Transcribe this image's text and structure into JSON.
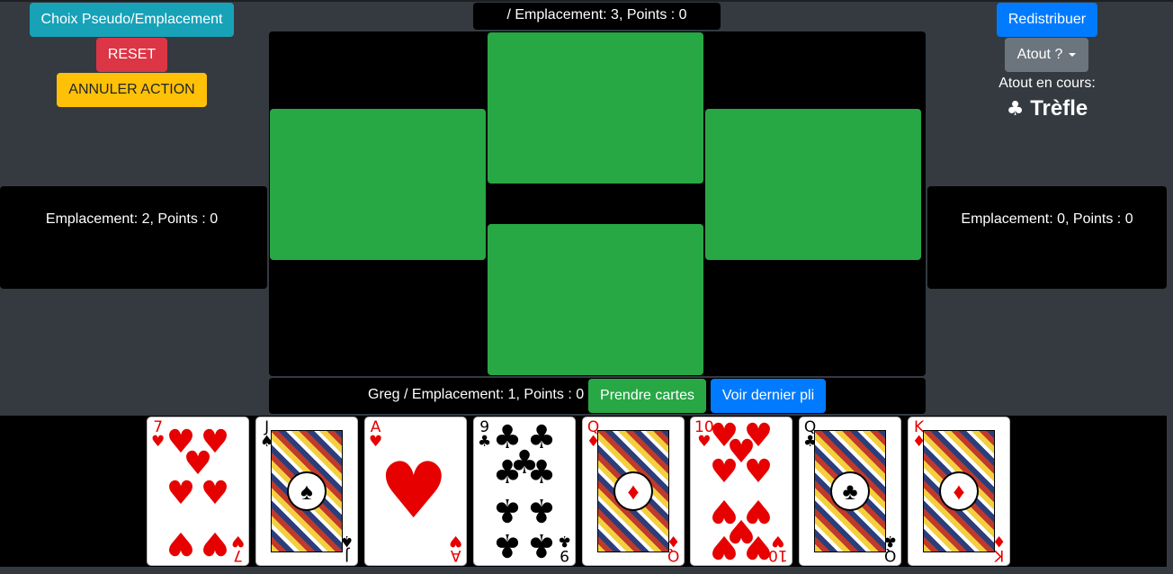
{
  "controls": {
    "choose_pseudo": "Choix Pseudo/Emplacement",
    "reset": "RESET",
    "cancel_action": "ANNULER ACTION",
    "redeal": "Redistribuer",
    "trump_dropdown": "Atout ?",
    "take_cards": "Prendre cartes",
    "view_last_trick": "Voir dernier pli"
  },
  "trump": {
    "label": "Atout en cours:",
    "suit_symbol": "♣",
    "suit_name": "Trèfle"
  },
  "players": {
    "top": "/ Emplacement: 3, Points : 0",
    "left": "Emplacement: 2, Points : 0",
    "right": "Emplacement: 0, Points : 0",
    "bottom": "Greg / Emplacement: 1, Points : 0"
  },
  "colors": {
    "background": "#343a40",
    "table": "#000000",
    "slot": "#28a745",
    "info": "#17a2b8",
    "danger": "#dc3545",
    "warning": "#ffc107",
    "primary": "#007bff",
    "secondary": "#6c757d"
  },
  "hand": [
    {
      "rank": "7",
      "suit": "♥",
      "color": "red",
      "kind": "pips"
    },
    {
      "rank": "J",
      "suit": "♠",
      "color": "black",
      "kind": "face"
    },
    {
      "rank": "A",
      "suit": "♥",
      "color": "red",
      "kind": "ace"
    },
    {
      "rank": "9",
      "suit": "♣",
      "color": "black",
      "kind": "pips"
    },
    {
      "rank": "Q",
      "suit": "♦",
      "color": "red",
      "kind": "face"
    },
    {
      "rank": "10",
      "suit": "♥",
      "color": "red",
      "kind": "pips"
    },
    {
      "rank": "Q",
      "suit": "♣",
      "color": "black",
      "kind": "face"
    },
    {
      "rank": "K",
      "suit": "♦",
      "color": "red",
      "kind": "face"
    }
  ]
}
